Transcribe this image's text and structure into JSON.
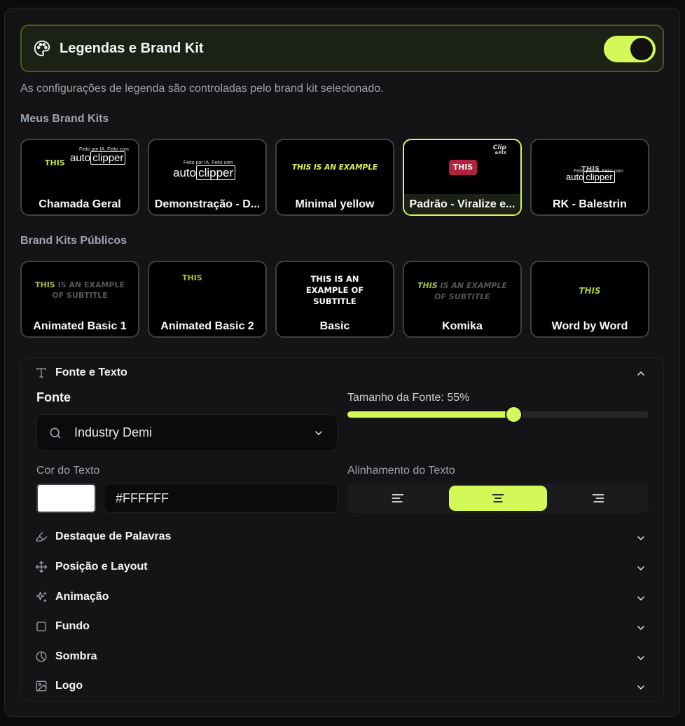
{
  "header": {
    "title": "Legendas e Brand Kit",
    "toggle_on": true,
    "accent": "#d4f857"
  },
  "subtitle": "As configurações de legenda são controladas pelo brand kit selecionado.",
  "my_kits": {
    "label": "Meus Brand Kits",
    "items": [
      {
        "name": "Chamada Geral",
        "preview_word": "THIS",
        "logo_tag": "Feito por IA. Feito com",
        "logo_a": "auto",
        "logo_b": "clipper"
      },
      {
        "name": "Demonstração - D...",
        "logo_tag": "Feito por IA. Feito com",
        "logo_a": "auto",
        "logo_b": "clipper"
      },
      {
        "name": "Minimal yellow",
        "preview_text": "THIS IS AN EXAMPLE"
      },
      {
        "name": "Padrão - Viralize e...",
        "preview_word": "THIS",
        "corner_logo_a": "Clip",
        "corner_logo_b": "&PIX",
        "selected": true
      },
      {
        "name": "RK - Balestrin",
        "preview_word": "THIS",
        "logo_tag": "Feito por IA. Feito com",
        "logo_a": "auto",
        "logo_b": "clipper"
      }
    ]
  },
  "public_kits": {
    "label": "Brand Kits Públicos",
    "items": [
      {
        "name": "Animated Basic 1",
        "line1_a": "THIS",
        "line1_b": "IS AN EXAMPLE",
        "line2": "OF SUBTITLE"
      },
      {
        "name": "Animated Basic 2",
        "line1_a": "THIS"
      },
      {
        "name": "Basic",
        "line1": "THIS IS AN",
        "line2": "EXAMPLE OF",
        "line3": "SUBTITLE"
      },
      {
        "name": "Komika",
        "line1_a": "THIS",
        "line1_b": "IS AN EXAMPLE",
        "line2": "OF SUBTITLE"
      },
      {
        "name": "Word by Word",
        "line1_a": "THIS"
      }
    ]
  },
  "font_section": {
    "title": "Fonte e Texto",
    "font_label": "Fonte",
    "font_value": "Industry Demi",
    "size_label": "Tamanho da Fonte: 55%",
    "size_percent": 55,
    "color_label": "Cor do Texto",
    "color_value": "#FFFFFF",
    "align_label": "Alinhamento do Texto",
    "align_selected": "center"
  },
  "collapsed_sections": [
    {
      "title": "Destaque de Palavras",
      "icon": "highlighter-icon"
    },
    {
      "title": "Posição e Layout",
      "icon": "move-icon"
    },
    {
      "title": "Animação",
      "icon": "sparkles-icon"
    },
    {
      "title": "Fundo",
      "icon": "square-icon"
    },
    {
      "title": "Sombra",
      "icon": "shadow-circle-icon"
    },
    {
      "title": "Logo",
      "icon": "image-icon"
    }
  ]
}
